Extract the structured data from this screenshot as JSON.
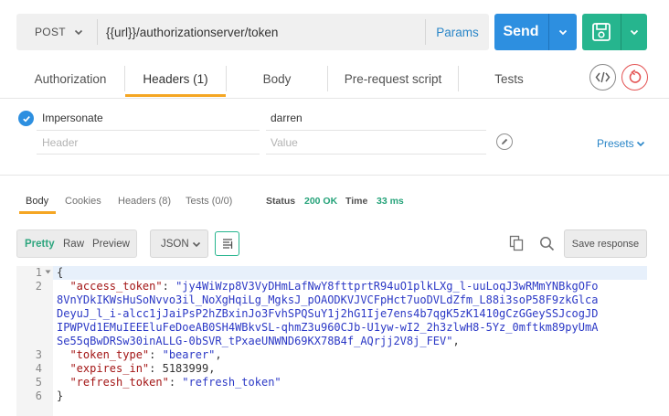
{
  "request": {
    "method": "POST",
    "url": "{{url}}/authorizationserver/token",
    "params_label": "Params",
    "send_label": "Send"
  },
  "tabs": [
    {
      "label": "Authorization",
      "active": false
    },
    {
      "label": "Headers (1)",
      "active": true
    },
    {
      "label": "Body",
      "active": false
    },
    {
      "label": "Pre-request script",
      "active": false
    },
    {
      "label": "Tests",
      "active": false
    }
  ],
  "headers": {
    "rows": [
      {
        "key": "Impersonate",
        "value": "darren",
        "enabled": true
      }
    ],
    "key_placeholder": "Header",
    "value_placeholder": "Value",
    "presets_label": "Presets"
  },
  "response": {
    "tabs": [
      {
        "label": "Body",
        "active": true
      },
      {
        "label": "Cookies",
        "active": false
      },
      {
        "label": "Headers (8)",
        "active": false
      },
      {
        "label": "Tests (0/0)",
        "active": false
      }
    ],
    "status_label": "Status",
    "status_value": "200 OK",
    "time_label": "Time",
    "time_value": "33 ms",
    "view_modes": [
      "Pretty",
      "Raw",
      "Preview"
    ],
    "active_view": "Pretty",
    "format": "JSON",
    "save_response_label": "Save response"
  },
  "code": {
    "line_numbers": [
      "1",
      "2",
      "",
      "",
      "",
      "",
      "3",
      "4",
      "5",
      "6"
    ],
    "open_brace": "{",
    "close_brace": "}",
    "access_token_key": "\"access_token\"",
    "access_token_lines": [
      "\"jy4WiWzp8V3VyDHmLafNwY8fttprtR94uO1plkLXg_l-uuLoqJ3wRMmYNBkgOFo",
      "8VnYDkIKWsHuSoNvvo3il_NoXgHqiLg_MgksJ_pOAODKVJVCFpHct7uoDVLdZfm_L88i3soP58F9zkGlca",
      "DeyuJ_l_i-alcc1jJaiPsP2hZBxinJo3FvhSPQSuY1j2hG1Ije7ens4b7qgK5zK1410gCzGGeySSJcogJD",
      "IPWPVd1EMuIEEEluFeDoeAB0SH4WBkvSL-qhmZ3u960CJb-U1yw-wI2_2h3zlwH8-5Yz_0mftkm89pyUmA",
      "Se55qBwDRSw30inALLG-0bSVR_tPxaeUNWND69KX78B4f_AQrjj2V8j_FEV\""
    ],
    "token_type_key": "\"token_type\"",
    "token_type_value": "\"bearer\"",
    "expires_in_key": "\"expires_in\"",
    "expires_in_value": "5183999",
    "refresh_token_key": "\"refresh_token\"",
    "refresh_token_value": "\"refresh_token\""
  },
  "colors": {
    "send_blue": "#2d8fe0",
    "save_green": "#26b58e",
    "tab_accent": "#f5a623",
    "status_green": "#26a37a",
    "link_blue": "#2a86c8"
  }
}
